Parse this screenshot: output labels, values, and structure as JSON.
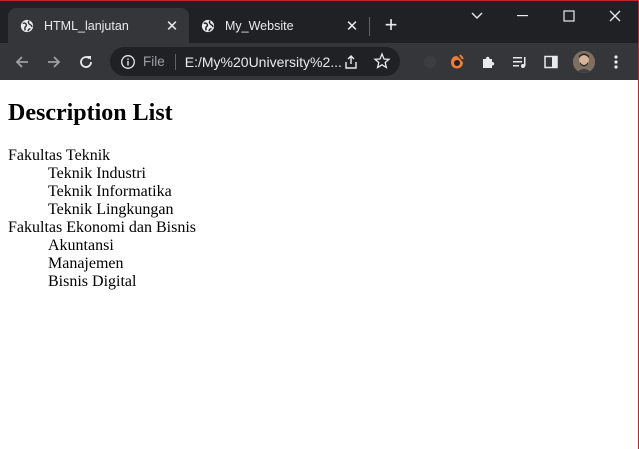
{
  "browser": {
    "tabs": [
      {
        "title": "HTML_lanjutan",
        "active": true
      },
      {
        "title": "My_Website",
        "active": false
      }
    ],
    "omnibox": {
      "scheme_label": "File",
      "url": "E:/My%20University%2..."
    },
    "icons": {
      "back": "arrow-left-icon",
      "forward": "arrow-right-icon",
      "reload": "reload-icon",
      "info": "info-icon",
      "share": "share-icon",
      "bookmark": "star-icon",
      "extension": "orange-extension-icon",
      "extensions": "puzzle-icon",
      "media": "media-playlist-icon",
      "sidepanel": "side-panel-icon",
      "menu": "kebab-menu-icon"
    }
  },
  "page": {
    "heading": "Description List",
    "groups": [
      {
        "term": "Fakultas Teknik",
        "items": [
          "Teknik Industri",
          "Teknik Informatika",
          "Teknik Lingkungan"
        ]
      },
      {
        "term": "Fakultas Ekonomi dan Bisnis",
        "items": [
          "Akuntansi",
          "Manajemen",
          "Bisnis Digital"
        ]
      }
    ]
  },
  "colors": {
    "chrome_dark": "#202124",
    "chrome_toolbar": "#35363a",
    "accent_border": "#c0262d",
    "extension_orange": "#f27b35"
  }
}
